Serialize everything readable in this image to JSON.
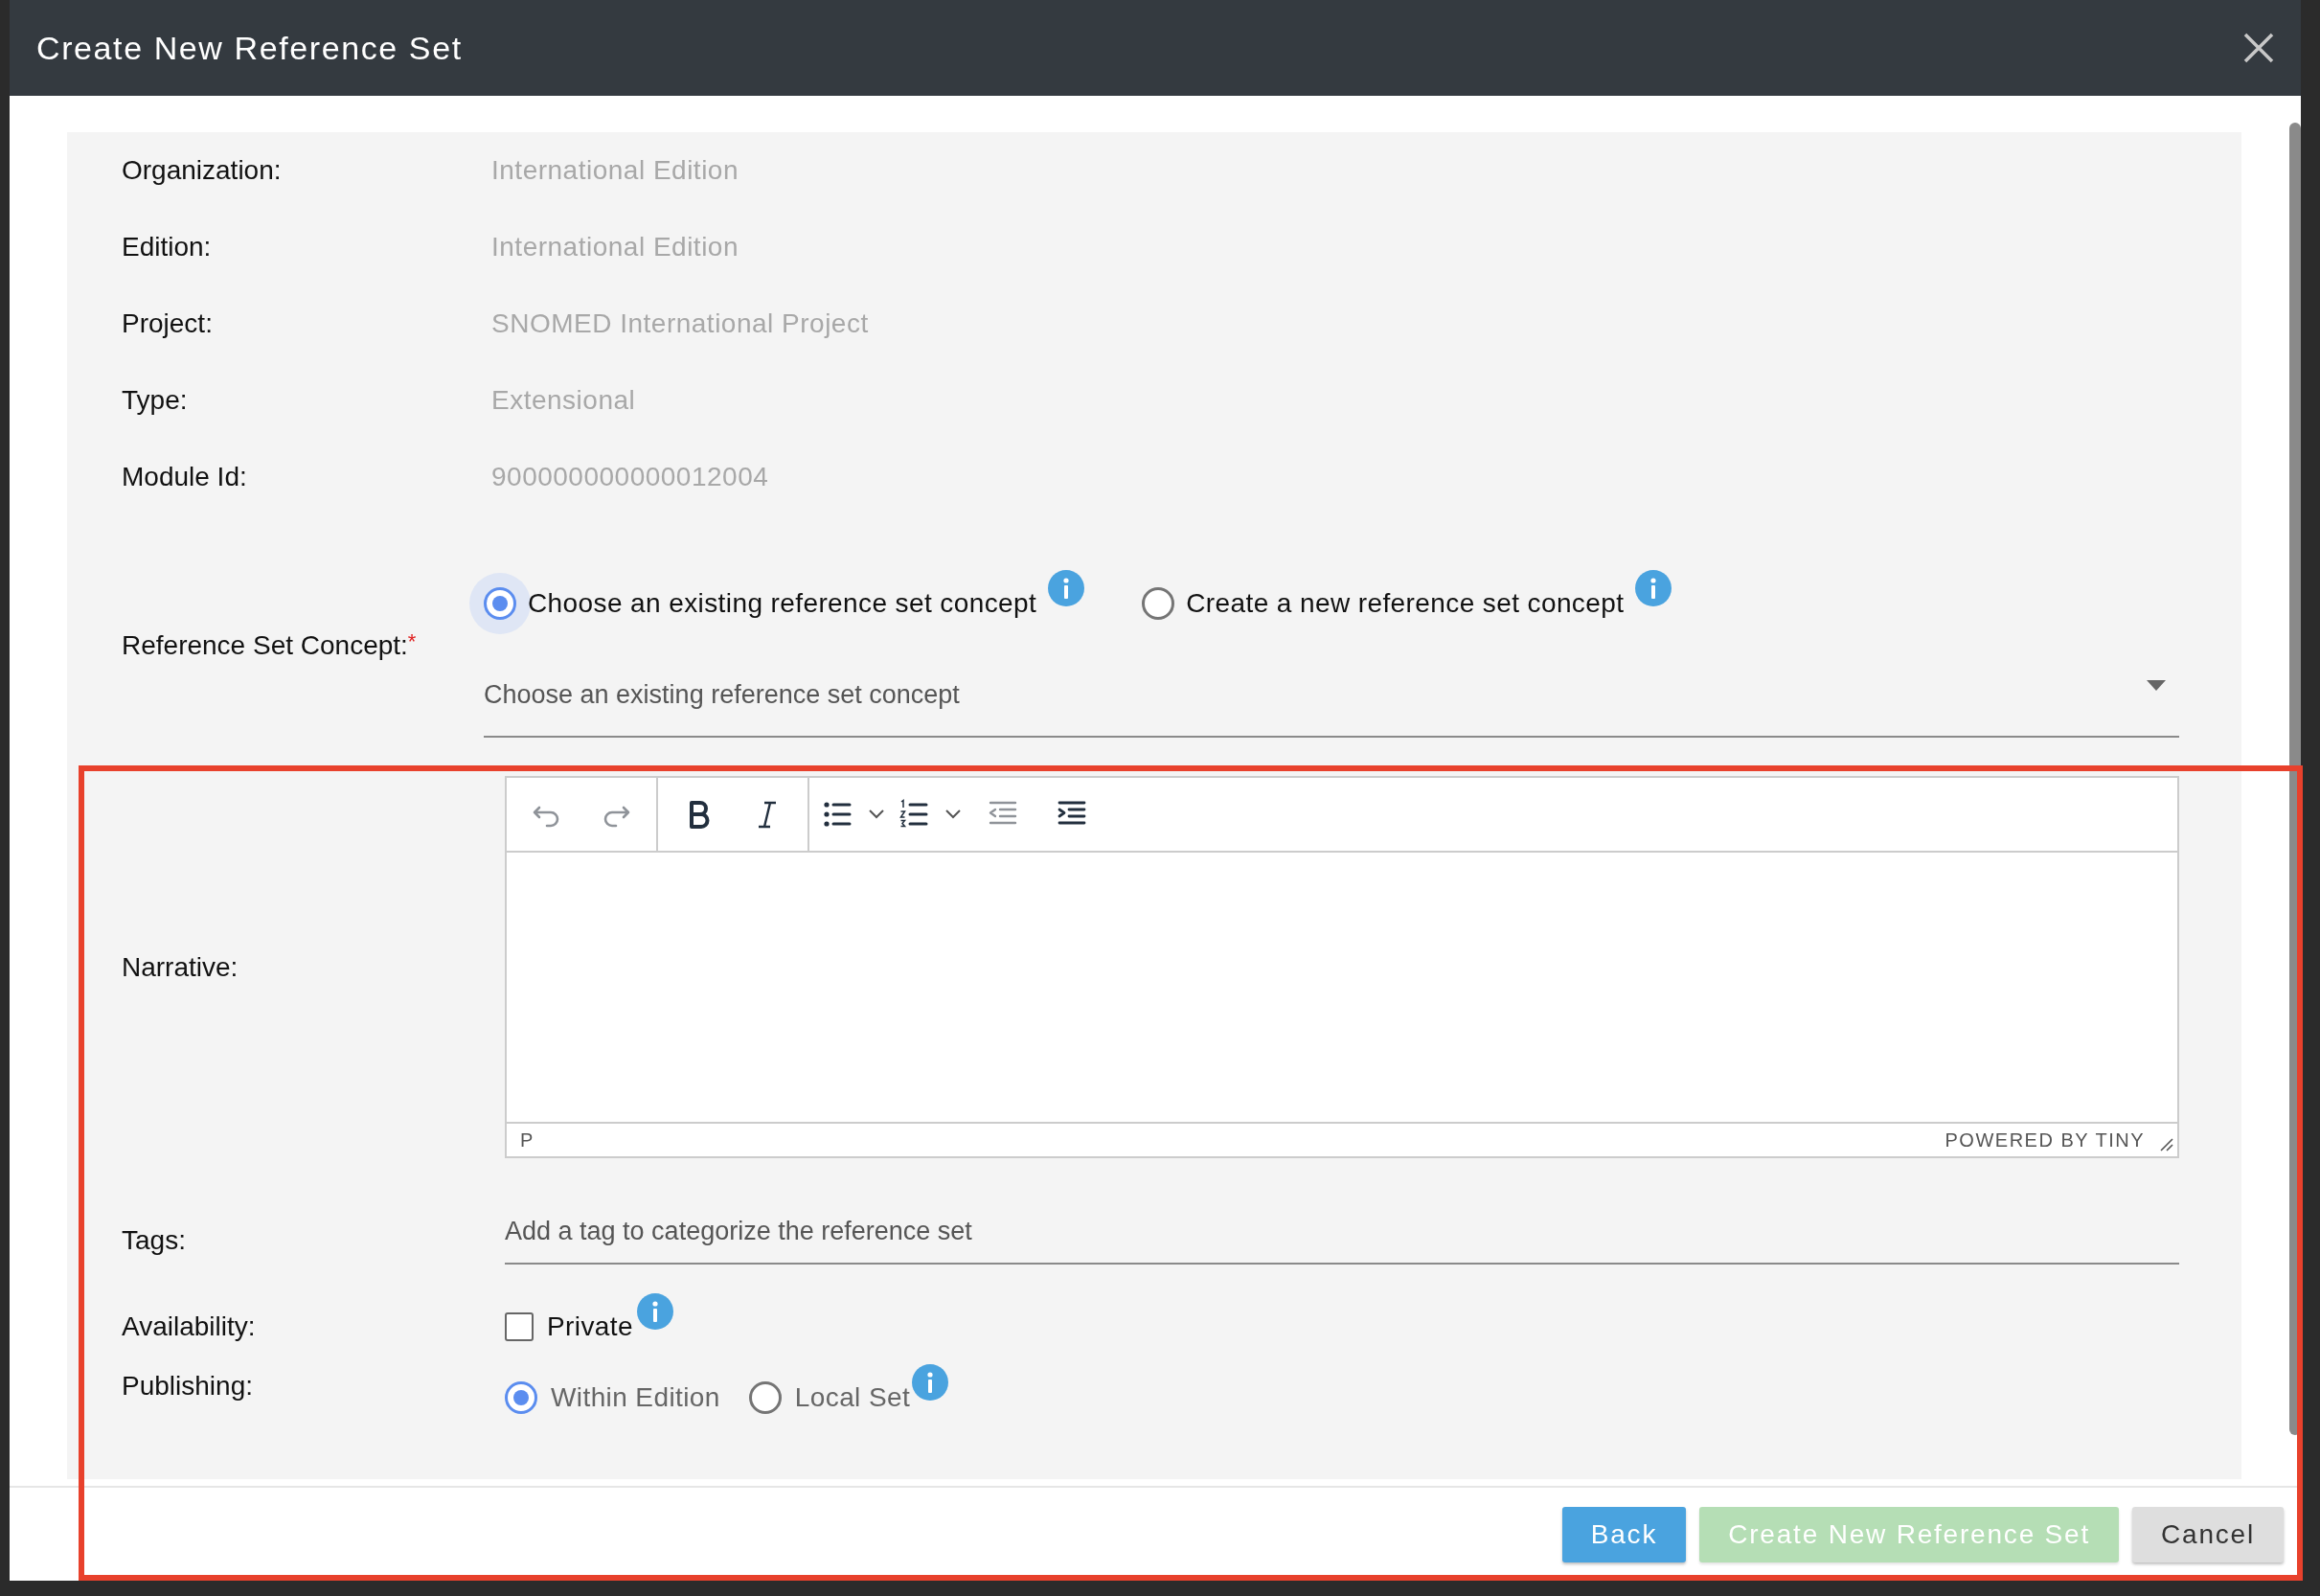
{
  "dialog": {
    "title": "Create New Reference Set"
  },
  "details": [
    {
      "label": "Organization:",
      "value": "International Edition"
    },
    {
      "label": "Edition:",
      "value": "International Edition"
    },
    {
      "label": "Project:",
      "value": "SNOMED International Project"
    },
    {
      "label": "Type:",
      "value": "Extensional"
    },
    {
      "label": "Module Id:",
      "value": "900000000000012004"
    }
  ],
  "concept": {
    "label": "Reference Set Concept:",
    "required_mark": "*",
    "options": [
      {
        "label": "Choose an existing reference set concept",
        "selected": true,
        "focused": true,
        "info": true
      },
      {
        "label": "Create a new reference set concept",
        "selected": false,
        "focused": false,
        "info": true
      }
    ],
    "select": {
      "placeholder": "Choose an existing reference set concept"
    }
  },
  "narrative": {
    "label": "Narrative:",
    "toolbar": [
      {
        "kind": "undo",
        "disabled": true
      },
      {
        "kind": "redo",
        "disabled": true
      },
      {
        "kind": "bold",
        "disabled": false
      },
      {
        "kind": "italic",
        "disabled": false
      },
      {
        "kind": "bullist",
        "disabled": false
      },
      {
        "kind": "numlist",
        "disabled": false
      },
      {
        "kind": "outdent",
        "disabled": true
      },
      {
        "kind": "indent",
        "disabled": false
      }
    ],
    "path": "P",
    "branding": "POWERED BY TINY"
  },
  "tags": {
    "label": "Tags:",
    "placeholder": "Add a tag to categorize the reference set"
  },
  "availability": {
    "label": "Availability:",
    "options": [
      {
        "label": "Private",
        "checked": false,
        "info": true
      }
    ]
  },
  "publishing": {
    "label": "Publishing:",
    "options": [
      {
        "label": "Within Edition",
        "selected": true,
        "info": false
      },
      {
        "label": "Local Set",
        "selected": false,
        "info": true
      }
    ]
  },
  "buttons": [
    {
      "label": "Back",
      "kind": "primary",
      "disabled": false
    },
    {
      "label": "Create New Reference Set",
      "kind": "success",
      "disabled": true
    },
    {
      "label": "Cancel",
      "kind": "secondary",
      "disabled": false
    }
  ]
}
